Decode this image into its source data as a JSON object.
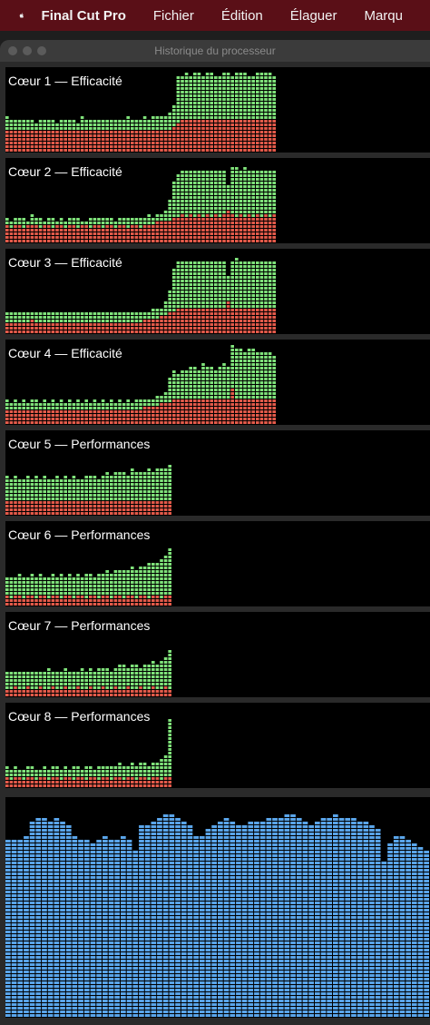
{
  "menubar": {
    "apple_icon": "apple-logo-icon",
    "app_name": "Final Cut Pro",
    "items": [
      "Fichier",
      "Édition",
      "Élaguer",
      "Marqu"
    ]
  },
  "window": {
    "title": "Historique du processeur"
  },
  "colors": {
    "user": "#7fe27a",
    "system": "#e35a4a",
    "gpu": "#5aa5ea",
    "empty": "#000000",
    "menubar": "#5a0f17"
  },
  "cores": [
    {
      "label": "Cœur 1 — Efficacité",
      "user": [
        0.42,
        0.38,
        0.4,
        0.37,
        0.41,
        0.39,
        0.38,
        0.36,
        0.4,
        0.37,
        0.39,
        0.38,
        0.36,
        0.4,
        0.37,
        0.41,
        0.38,
        0.36,
        0.42,
        0.37,
        0.39,
        0.38,
        0.4,
        0.37,
        0.41,
        0.39,
        0.38,
        0.4,
        0.37,
        0.42,
        0.39,
        0.38,
        0.4,
        0.42,
        0.41,
        0.43,
        0.44,
        0.42,
        0.45,
        0.48,
        0.58,
        0.92,
        0.93,
        0.94,
        0.93,
        0.95,
        0.94,
        0.93,
        0.95,
        0.94,
        0.93,
        0.92,
        0.95,
        0.94,
        0.93,
        0.96,
        0.95,
        0.94,
        0.93,
        0.92,
        0.95,
        0.94,
        0.96,
        0.95,
        0.93
      ],
      "system": [
        0.25,
        0.24,
        0.26,
        0.25,
        0.24,
        0.26,
        0.25,
        0.24,
        0.26,
        0.25,
        0.24,
        0.26,
        0.25,
        0.24,
        0.26,
        0.25,
        0.24,
        0.26,
        0.25,
        0.24,
        0.26,
        0.25,
        0.24,
        0.26,
        0.25,
        0.24,
        0.26,
        0.25,
        0.24,
        0.26,
        0.25,
        0.24,
        0.26,
        0.25,
        0.24,
        0.26,
        0.25,
        0.26,
        0.27,
        0.28,
        0.3,
        0.36,
        0.37,
        0.38,
        0.37,
        0.38,
        0.37,
        0.38,
        0.37,
        0.38,
        0.37,
        0.38,
        0.37,
        0.39,
        0.38,
        0.4,
        0.38,
        0.37,
        0.38,
        0.37,
        0.38,
        0.37,
        0.38,
        0.37,
        0.38
      ]
    },
    {
      "label": "Cœur 2 — Efficacité",
      "user": [
        0.3,
        0.28,
        0.32,
        0.29,
        0.31,
        0.27,
        0.36,
        0.29,
        0.3,
        0.28,
        0.31,
        0.29,
        0.27,
        0.3,
        0.28,
        0.31,
        0.29,
        0.3,
        0.28,
        0.27,
        0.31,
        0.29,
        0.3,
        0.32,
        0.29,
        0.3,
        0.28,
        0.31,
        0.3,
        0.29,
        0.32,
        0.31,
        0.3,
        0.32,
        0.33,
        0.31,
        0.34,
        0.36,
        0.4,
        0.5,
        0.72,
        0.84,
        0.86,
        0.85,
        0.87,
        0.86,
        0.88,
        0.87,
        0.86,
        0.88,
        0.87,
        0.86,
        0.88,
        0.7,
        0.9,
        0.91,
        0.89,
        0.9,
        0.88,
        0.87,
        0.89,
        0.88,
        0.87,
        0.86,
        0.85
      ],
      "system": [
        0.2,
        0.19,
        0.21,
        0.2,
        0.19,
        0.21,
        0.22,
        0.2,
        0.19,
        0.21,
        0.2,
        0.19,
        0.21,
        0.2,
        0.19,
        0.21,
        0.2,
        0.19,
        0.21,
        0.2,
        0.19,
        0.21,
        0.2,
        0.19,
        0.21,
        0.2,
        0.19,
        0.21,
        0.2,
        0.19,
        0.21,
        0.2,
        0.19,
        0.21,
        0.22,
        0.23,
        0.24,
        0.25,
        0.26,
        0.28,
        0.3,
        0.32,
        0.33,
        0.32,
        0.33,
        0.32,
        0.33,
        0.32,
        0.33,
        0.32,
        0.33,
        0.32,
        0.33,
        0.4,
        0.33,
        0.32,
        0.33,
        0.32,
        0.33,
        0.32,
        0.33,
        0.32,
        0.33,
        0.32,
        0.33
      ]
    },
    {
      "label": "Cœur 3 — Efficacité",
      "user": [
        0.26,
        0.25,
        0.27,
        0.26,
        0.24,
        0.25,
        0.27,
        0.24,
        0.26,
        0.25,
        0.27,
        0.24,
        0.26,
        0.25,
        0.27,
        0.26,
        0.24,
        0.26,
        0.25,
        0.27,
        0.26,
        0.24,
        0.26,
        0.27,
        0.25,
        0.26,
        0.24,
        0.27,
        0.25,
        0.26,
        0.27,
        0.26,
        0.25,
        0.28,
        0.27,
        0.29,
        0.3,
        0.32,
        0.38,
        0.52,
        0.8,
        0.86,
        0.87,
        0.86,
        0.88,
        0.87,
        0.86,
        0.88,
        0.87,
        0.88,
        0.89,
        0.88,
        0.87,
        0.7,
        0.89,
        0.9,
        0.89,
        0.88,
        0.89,
        0.88,
        0.87,
        0.88,
        0.87,
        0.86,
        0.88
      ],
      "system": [
        0.14,
        0.13,
        0.15,
        0.14,
        0.13,
        0.15,
        0.16,
        0.14,
        0.13,
        0.15,
        0.14,
        0.13,
        0.15,
        0.14,
        0.13,
        0.15,
        0.14,
        0.13,
        0.15,
        0.14,
        0.13,
        0.15,
        0.14,
        0.13,
        0.15,
        0.14,
        0.13,
        0.15,
        0.14,
        0.13,
        0.15,
        0.14,
        0.13,
        0.16,
        0.17,
        0.18,
        0.19,
        0.2,
        0.22,
        0.24,
        0.27,
        0.3,
        0.31,
        0.3,
        0.31,
        0.3,
        0.31,
        0.3,
        0.31,
        0.3,
        0.31,
        0.3,
        0.31,
        0.38,
        0.31,
        0.3,
        0.31,
        0.3,
        0.31,
        0.3,
        0.31,
        0.3,
        0.31,
        0.3,
        0.31
      ]
    },
    {
      "label": "Cœur 4 — Efficacité",
      "user": [
        0.3,
        0.28,
        0.29,
        0.27,
        0.3,
        0.28,
        0.31,
        0.29,
        0.27,
        0.3,
        0.28,
        0.29,
        0.27,
        0.3,
        0.28,
        0.29,
        0.27,
        0.3,
        0.28,
        0.29,
        0.27,
        0.3,
        0.28,
        0.29,
        0.27,
        0.3,
        0.28,
        0.29,
        0.27,
        0.3,
        0.28,
        0.29,
        0.31,
        0.3,
        0.32,
        0.31,
        0.33,
        0.35,
        0.4,
        0.55,
        0.65,
        0.62,
        0.66,
        0.64,
        0.68,
        0.7,
        0.66,
        0.72,
        0.7,
        0.68,
        0.66,
        0.7,
        0.72,
        0.68,
        0.94,
        0.92,
        0.9,
        0.88,
        0.92,
        0.9,
        0.88,
        0.86,
        0.88,
        0.86,
        0.84
      ],
      "system": [
        0.18,
        0.17,
        0.19,
        0.18,
        0.17,
        0.19,
        0.18,
        0.17,
        0.19,
        0.18,
        0.17,
        0.19,
        0.18,
        0.17,
        0.19,
        0.18,
        0.17,
        0.19,
        0.18,
        0.17,
        0.19,
        0.18,
        0.17,
        0.19,
        0.18,
        0.17,
        0.19,
        0.18,
        0.17,
        0.19,
        0.18,
        0.17,
        0.19,
        0.2,
        0.21,
        0.22,
        0.23,
        0.24,
        0.26,
        0.28,
        0.3,
        0.31,
        0.32,
        0.31,
        0.32,
        0.31,
        0.32,
        0.31,
        0.32,
        0.31,
        0.32,
        0.31,
        0.32,
        0.31,
        0.44,
        0.32,
        0.31,
        0.32,
        0.31,
        0.32,
        0.31,
        0.32,
        0.31,
        0.32,
        0.31
      ]
    },
    {
      "label": "Cœur 5 — Performances",
      "user": [
        0.46,
        0.44,
        0.47,
        0.45,
        0.43,
        0.46,
        0.44,
        0.47,
        0.45,
        0.46,
        0.44,
        0.43,
        0.46,
        0.45,
        0.47,
        0.44,
        0.46,
        0.43,
        0.45,
        0.47,
        0.46,
        0.48,
        0.45,
        0.49,
        0.5,
        0.48,
        0.52,
        0.5,
        0.53,
        0.49,
        0.55,
        0.51,
        0.54,
        0.52,
        0.55,
        0.53,
        0.56,
        0.58,
        0.56,
        0.63
      ],
      "system": [
        0.18,
        0.17,
        0.19,
        0.18,
        0.17,
        0.19,
        0.18,
        0.17,
        0.19,
        0.18,
        0.17,
        0.19,
        0.18,
        0.17,
        0.19,
        0.18,
        0.17,
        0.19,
        0.18,
        0.17,
        0.19,
        0.18,
        0.17,
        0.19,
        0.18,
        0.17,
        0.19,
        0.18,
        0.17,
        0.19,
        0.18,
        0.17,
        0.19,
        0.18,
        0.17,
        0.19,
        0.18,
        0.17,
        0.19,
        0.18
      ]
    },
    {
      "label": "Cœur 6 — Performances",
      "user": [
        0.34,
        0.36,
        0.35,
        0.37,
        0.34,
        0.36,
        0.38,
        0.35,
        0.37,
        0.36,
        0.35,
        0.38,
        0.36,
        0.37,
        0.35,
        0.38,
        0.36,
        0.37,
        0.35,
        0.39,
        0.37,
        0.36,
        0.4,
        0.38,
        0.42,
        0.4,
        0.44,
        0.42,
        0.45,
        0.43,
        0.46,
        0.44,
        0.48,
        0.46,
        0.5,
        0.52,
        0.54,
        0.56,
        0.6,
        0.68
      ],
      "system": [
        0.11,
        0.1,
        0.12,
        0.11,
        0.1,
        0.12,
        0.11,
        0.1,
        0.12,
        0.11,
        0.1,
        0.12,
        0.11,
        0.1,
        0.12,
        0.11,
        0.1,
        0.12,
        0.11,
        0.1,
        0.12,
        0.11,
        0.1,
        0.12,
        0.11,
        0.1,
        0.12,
        0.11,
        0.1,
        0.12,
        0.11,
        0.1,
        0.12,
        0.11,
        0.1,
        0.12,
        0.11,
        0.1,
        0.12,
        0.11
      ]
    },
    {
      "label": "Cœur 7 — Performances",
      "user": [
        0.3,
        0.31,
        0.29,
        0.32,
        0.3,
        0.31,
        0.29,
        0.32,
        0.3,
        0.31,
        0.33,
        0.3,
        0.32,
        0.31,
        0.33,
        0.3,
        0.32,
        0.31,
        0.34,
        0.32,
        0.33,
        0.31,
        0.35,
        0.33,
        0.34,
        0.32,
        0.36,
        0.4,
        0.38,
        0.35,
        0.37,
        0.39,
        0.36,
        0.38,
        0.4,
        0.42,
        0.4,
        0.44,
        0.46,
        0.55
      ],
      "system": [
        0.1,
        0.09,
        0.11,
        0.1,
        0.09,
        0.11,
        0.1,
        0.09,
        0.11,
        0.1,
        0.09,
        0.11,
        0.1,
        0.09,
        0.11,
        0.1,
        0.09,
        0.11,
        0.1,
        0.09,
        0.11,
        0.1,
        0.09,
        0.11,
        0.1,
        0.09,
        0.11,
        0.1,
        0.09,
        0.11,
        0.1,
        0.09,
        0.11,
        0.1,
        0.09,
        0.11,
        0.1,
        0.09,
        0.11,
        0.1
      ]
    },
    {
      "label": "Cœur 8 — Performances",
      "user": [
        0.24,
        0.22,
        0.25,
        0.23,
        0.22,
        0.24,
        0.26,
        0.23,
        0.22,
        0.25,
        0.23,
        0.27,
        0.24,
        0.22,
        0.25,
        0.23,
        0.26,
        0.24,
        0.22,
        0.27,
        0.25,
        0.23,
        0.26,
        0.24,
        0.28,
        0.25,
        0.27,
        0.29,
        0.26,
        0.28,
        0.3,
        0.27,
        0.29,
        0.31,
        0.28,
        0.3,
        0.32,
        0.35,
        0.4,
        0.82
      ],
      "system": [
        0.11,
        0.1,
        0.12,
        0.11,
        0.1,
        0.12,
        0.11,
        0.1,
        0.12,
        0.11,
        0.1,
        0.12,
        0.11,
        0.1,
        0.12,
        0.11,
        0.1,
        0.12,
        0.11,
        0.1,
        0.12,
        0.11,
        0.1,
        0.12,
        0.11,
        0.1,
        0.12,
        0.11,
        0.1,
        0.12,
        0.11,
        0.1,
        0.12,
        0.11,
        0.1,
        0.12,
        0.11,
        0.1,
        0.12,
        0.11
      ]
    }
  ],
  "gpu": {
    "values": [
      0.82,
      0.82,
      0.82,
      0.84,
      0.9,
      0.92,
      0.92,
      0.9,
      0.92,
      0.9,
      0.88,
      0.84,
      0.82,
      0.82,
      0.8,
      0.82,
      0.84,
      0.82,
      0.82,
      0.84,
      0.82,
      0.76,
      0.88,
      0.88,
      0.9,
      0.92,
      0.93,
      0.94,
      0.92,
      0.9,
      0.88,
      0.84,
      0.84,
      0.86,
      0.88,
      0.9,
      0.92,
      0.9,
      0.88,
      0.88,
      0.9,
      0.9,
      0.9,
      0.91,
      0.92,
      0.92,
      0.93,
      0.93,
      0.92,
      0.9,
      0.88,
      0.9,
      0.92,
      0.92,
      0.93,
      0.92,
      0.92,
      0.91,
      0.9,
      0.9,
      0.88,
      0.86,
      0.72,
      0.8,
      0.83,
      0.84,
      0.82,
      0.8,
      0.78,
      0.76
    ]
  }
}
